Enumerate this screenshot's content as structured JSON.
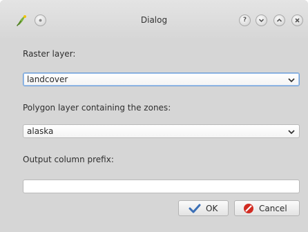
{
  "window": {
    "title": "Dialog"
  },
  "titlebar_buttons": [
    {
      "name": "help",
      "glyph": "?"
    },
    {
      "name": "minimize",
      "glyph": "chevron-down-icon"
    },
    {
      "name": "maximize",
      "glyph": "chevron-up-icon"
    },
    {
      "name": "close",
      "glyph": "close-icon"
    }
  ],
  "form": {
    "raster_label": "Raster layer:",
    "raster_value": "landcover",
    "polygon_label": "Polygon layer containing the zones:",
    "polygon_value": "alaska",
    "prefix_label": "Output column prefix:",
    "prefix_value": ""
  },
  "buttons": {
    "ok_label": "OK",
    "cancel_label": "Cancel"
  },
  "colors": {
    "focus_border": "#6f9fd6",
    "ok_check": "#3b6fb6",
    "cancel_red": "#d12b22"
  }
}
